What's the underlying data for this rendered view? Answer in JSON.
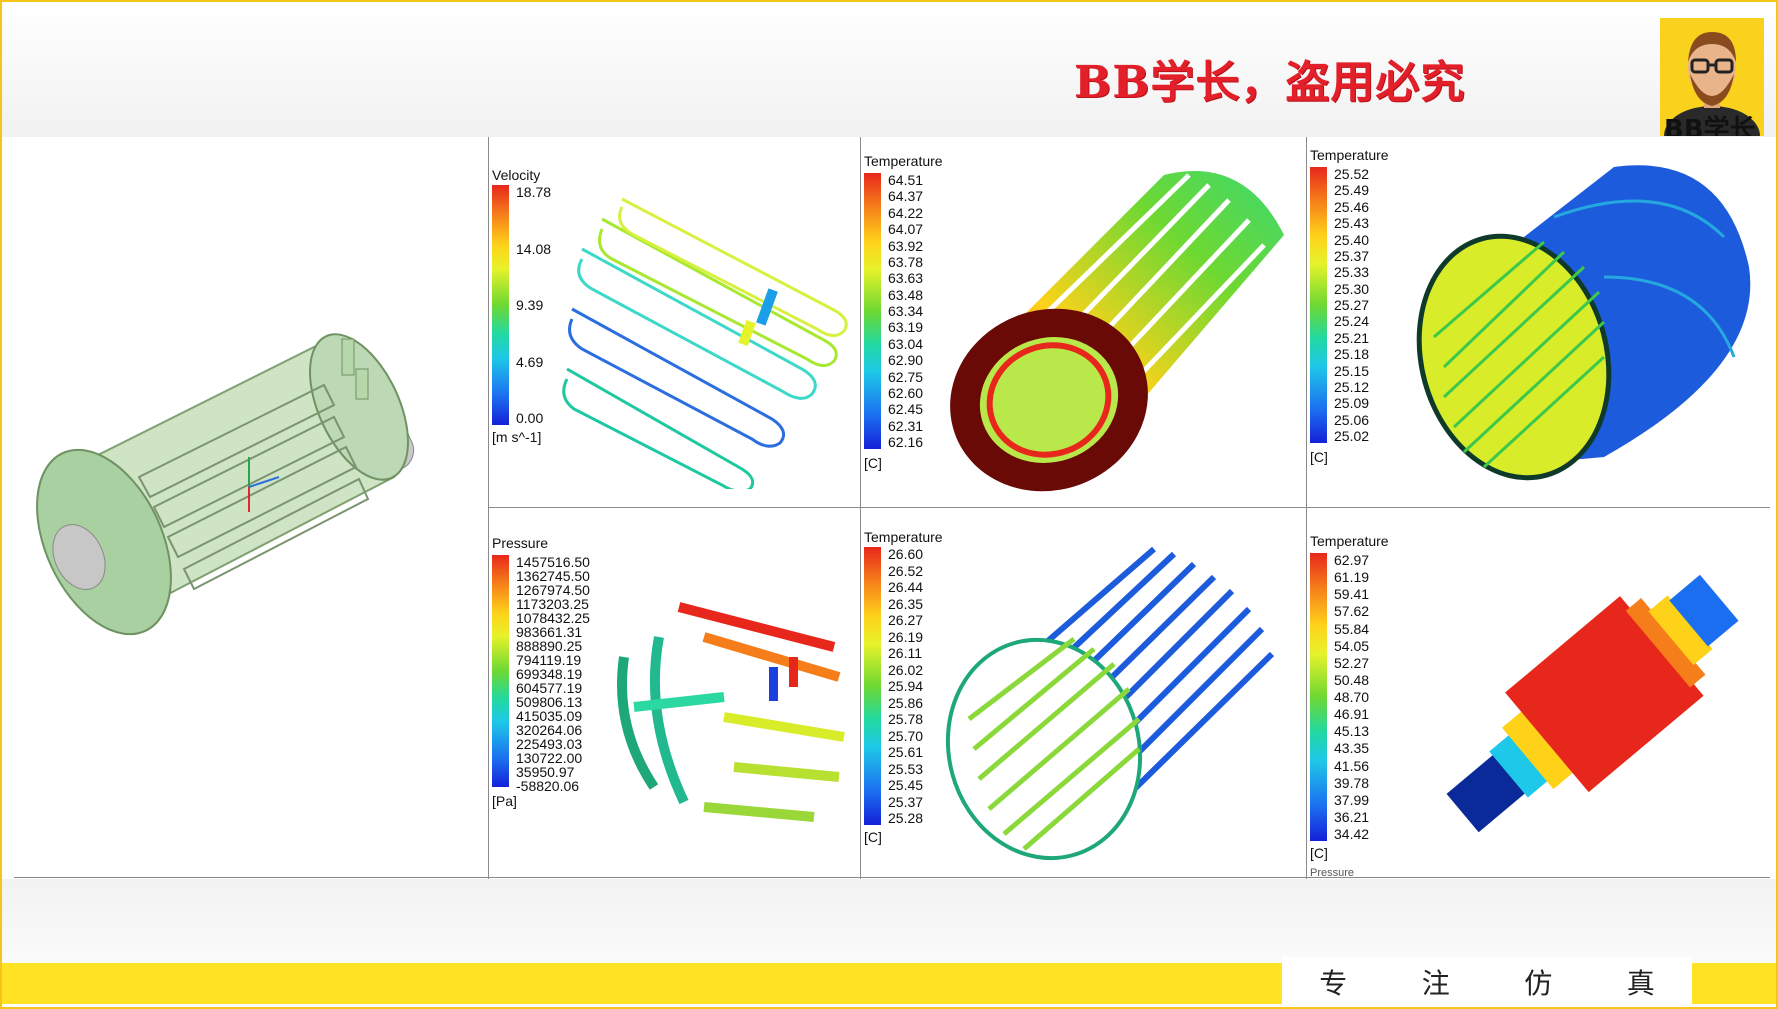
{
  "slide": {
    "watermark": "BB学长，盗用必究",
    "avatar_label": "BB学长",
    "footer_label": [
      "专",
      "注",
      "仿",
      "真"
    ],
    "colors": {
      "border": "#f5c518",
      "watermark": "#e3202a",
      "footer_band": "#ffe224"
    }
  },
  "panels": {
    "velocity": {
      "title": "Velocity",
      "ticks": [
        "18.78",
        "14.08",
        "9.39",
        "4.69",
        "0.00"
      ],
      "unit": "[m s^-1]"
    },
    "rotor_temperature": {
      "title": "Temperature",
      "ticks": [
        "64.51",
        "64.37",
        "64.22",
        "64.07",
        "63.92",
        "63.78",
        "63.63",
        "63.48",
        "63.34",
        "63.19",
        "63.04",
        "62.90",
        "62.75",
        "62.60",
        "62.45",
        "62.31",
        "62.16"
      ],
      "unit": "[C]"
    },
    "shell_temperature": {
      "title": "Temperature",
      "ticks": [
        "25.52",
        "25.49",
        "25.46",
        "25.43",
        "25.40",
        "25.37",
        "25.33",
        "25.30",
        "25.27",
        "25.24",
        "25.21",
        "25.18",
        "25.15",
        "25.12",
        "25.09",
        "25.06",
        "25.02"
      ],
      "unit": "[C]"
    },
    "pressure": {
      "title": "Pressure",
      "ticks": [
        "1457516.50",
        "1362745.50",
        "1267974.50",
        "1173203.25",
        "1078432.25",
        "983661.31",
        "888890.25",
        "794119.19",
        "699348.19",
        "604577.19",
        "509806.13",
        "415035.09",
        "320264.06",
        "225493.03",
        "130722.00",
        "35950.97",
        "-58820.06"
      ],
      "unit": "[Pa]"
    },
    "bars_temperature": {
      "title": "Temperature",
      "ticks": [
        "26.60",
        "26.52",
        "26.44",
        "26.35",
        "26.27",
        "26.19",
        "26.11",
        "26.02",
        "25.94",
        "25.86",
        "25.78",
        "25.70",
        "25.61",
        "25.53",
        "25.45",
        "25.37",
        "25.28"
      ],
      "unit": "[C]"
    },
    "shaft_temperature": {
      "title": "Temperature",
      "ticks": [
        "62.97",
        "61.19",
        "59.41",
        "57.62",
        "55.84",
        "54.05",
        "52.27",
        "50.48",
        "48.70",
        "46.91",
        "45.13",
        "43.35",
        "41.56",
        "39.78",
        "37.99",
        "36.21",
        "34.42"
      ],
      "unit": "[C]"
    },
    "cutoff_labels": [
      "Pressure"
    ]
  }
}
